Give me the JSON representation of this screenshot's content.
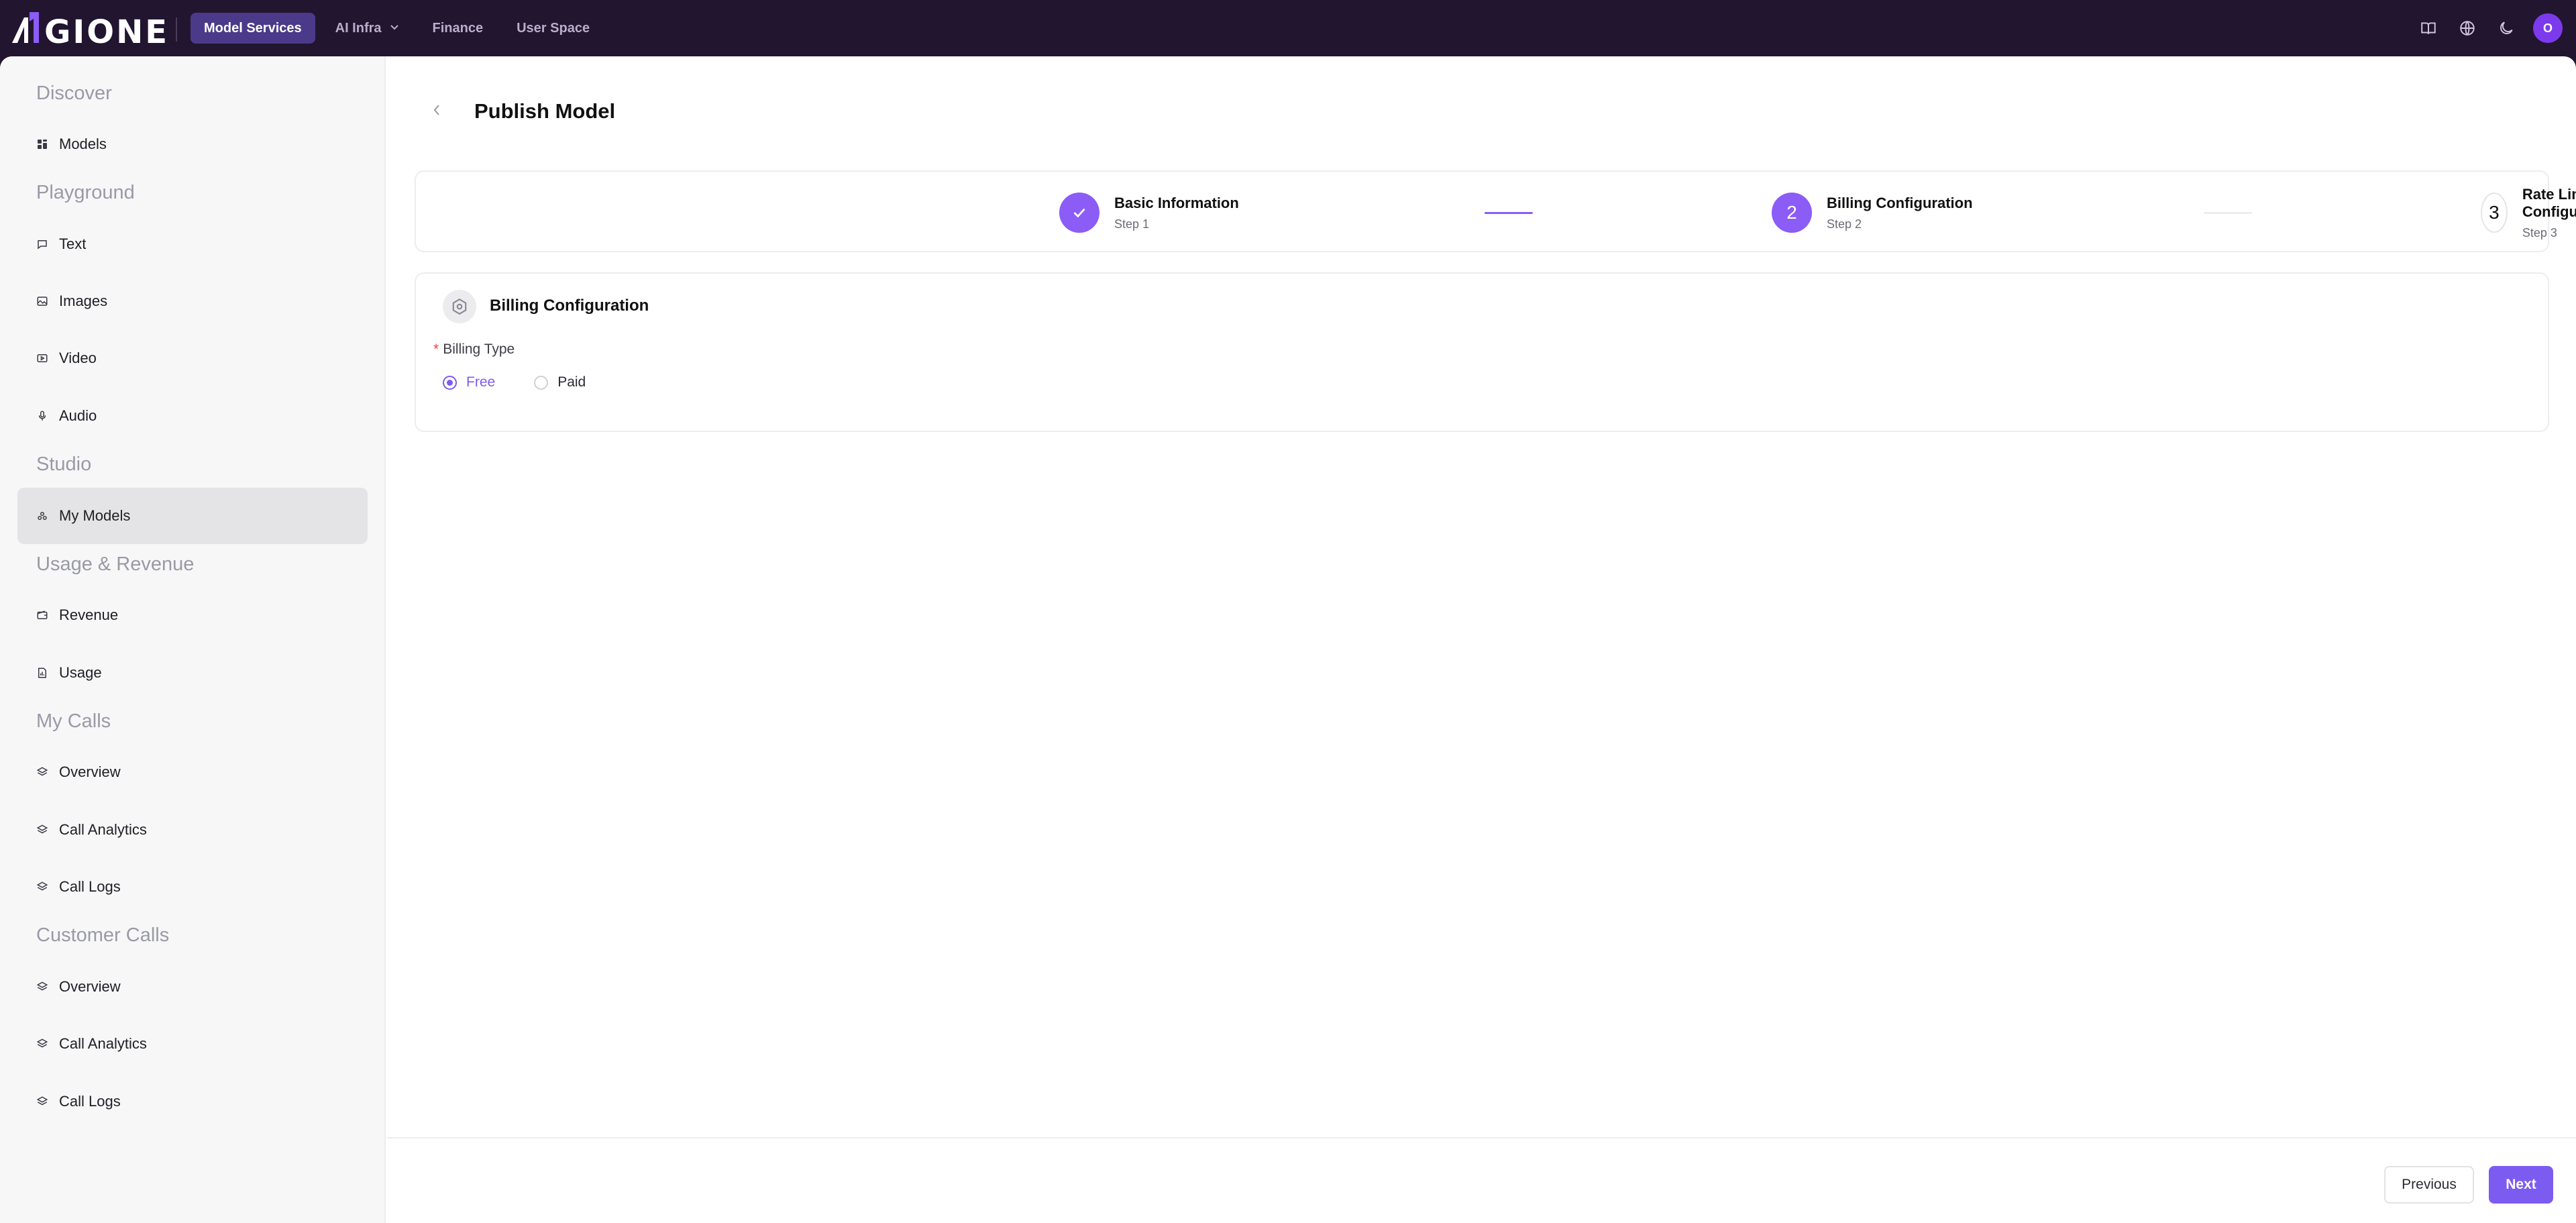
{
  "brand": {
    "logo_text": "AIGIONE",
    "accent_color": "#8b5cf6"
  },
  "topnav": {
    "items": [
      {
        "label": "Model Services",
        "active": true
      },
      {
        "label": "AI Infra",
        "has_dropdown": true
      },
      {
        "label": "Finance"
      },
      {
        "label": "User Space"
      }
    ],
    "actions": {
      "icons": [
        "book-icon",
        "globe-icon",
        "moon-icon"
      ],
      "avatar_initial": "O"
    }
  },
  "sidebar": {
    "sections": [
      {
        "title": "Discover",
        "items": [
          {
            "label": "Models",
            "icon": "grid-icon"
          }
        ]
      },
      {
        "title": "Playground",
        "items": [
          {
            "label": "Text",
            "icon": "chat-bubble-icon"
          },
          {
            "label": "Images",
            "icon": "image-icon"
          },
          {
            "label": "Video",
            "icon": "video-icon"
          },
          {
            "label": "Audio",
            "icon": "microphone-icon"
          }
        ]
      },
      {
        "title": "Studio",
        "items": [
          {
            "label": "My Models",
            "icon": "models-icon",
            "active": true
          }
        ]
      },
      {
        "title": "Usage & Revenue",
        "items": [
          {
            "label": "Revenue",
            "icon": "wallet-icon"
          },
          {
            "label": "Usage",
            "icon": "document-chart-icon"
          }
        ]
      },
      {
        "title": "My Calls",
        "items": [
          {
            "label": "Overview",
            "icon": "layers-icon"
          },
          {
            "label": "Call Analytics",
            "icon": "layers-icon"
          },
          {
            "label": "Call Logs",
            "icon": "layers-icon"
          }
        ]
      },
      {
        "title": "Customer Calls",
        "items": [
          {
            "label": "Overview",
            "icon": "layers-icon"
          },
          {
            "label": "Call Analytics",
            "icon": "layers-icon"
          },
          {
            "label": "Call Logs",
            "icon": "layers-icon"
          }
        ]
      }
    ]
  },
  "page": {
    "title": "Publish Model"
  },
  "steps": [
    {
      "number": "1",
      "title": "Basic Information",
      "subtitle": "Step 1",
      "status": "done"
    },
    {
      "number": "2",
      "title": "Billing Configuration",
      "subtitle": "Step 2",
      "status": "current"
    },
    {
      "number": "3",
      "title": "Rate Limit Configuration",
      "subtitle": "Step 3",
      "status": "pending"
    }
  ],
  "billing": {
    "title": "Billing Configuration",
    "field_label": "Billing Type",
    "required_mark": "*",
    "options": [
      {
        "label": "Free",
        "checked": true
      },
      {
        "label": "Paid",
        "checked": false
      }
    ]
  },
  "footer": {
    "previous_label": "Previous",
    "next_label": "Next"
  }
}
